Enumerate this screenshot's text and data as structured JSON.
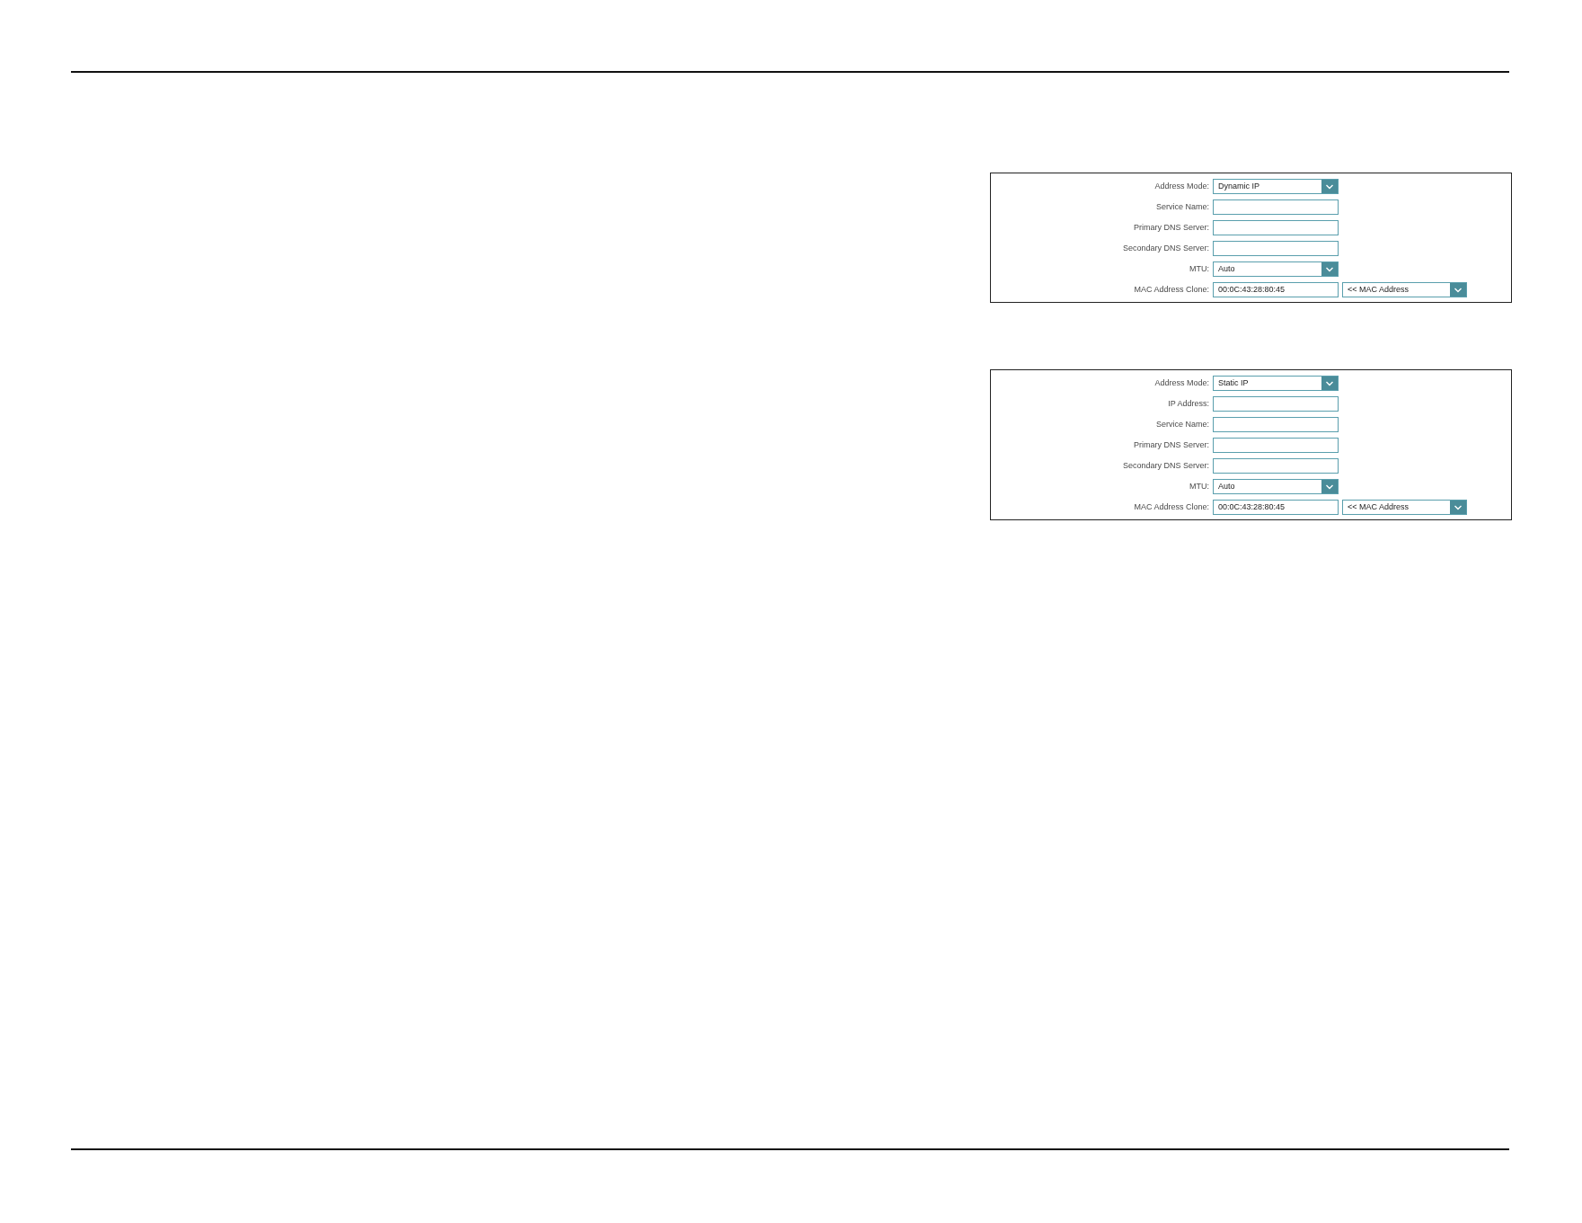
{
  "panels": [
    {
      "rows": [
        {
          "kind": "select",
          "label": "Address Mode:",
          "value": "Dynamic IP"
        },
        {
          "kind": "input",
          "label": "Service Name:"
        },
        {
          "kind": "input",
          "label": "Primary DNS Server:"
        },
        {
          "kind": "input",
          "label": "Secondary DNS Server:"
        },
        {
          "kind": "select",
          "label": "MTU:",
          "value": "Auto"
        },
        {
          "kind": "input_select",
          "label": "MAC Address Clone:",
          "value": "00:0C:43:28:80:45",
          "option": "<< MAC Address"
        }
      ]
    },
    {
      "rows": [
        {
          "kind": "select",
          "label": "Address Mode:",
          "value": "Static IP"
        },
        {
          "kind": "input",
          "label": "IP Address:"
        },
        {
          "kind": "input",
          "label": "Service Name:"
        },
        {
          "kind": "input",
          "label": "Primary DNS Server:"
        },
        {
          "kind": "input",
          "label": "Secondary DNS Server:"
        },
        {
          "kind": "select",
          "label": "MTU:",
          "value": "Auto"
        },
        {
          "kind": "input_select",
          "label": "MAC Address Clone:",
          "value": "00:0C:43:28:80:45",
          "option": "<< MAC Address"
        }
      ]
    }
  ]
}
